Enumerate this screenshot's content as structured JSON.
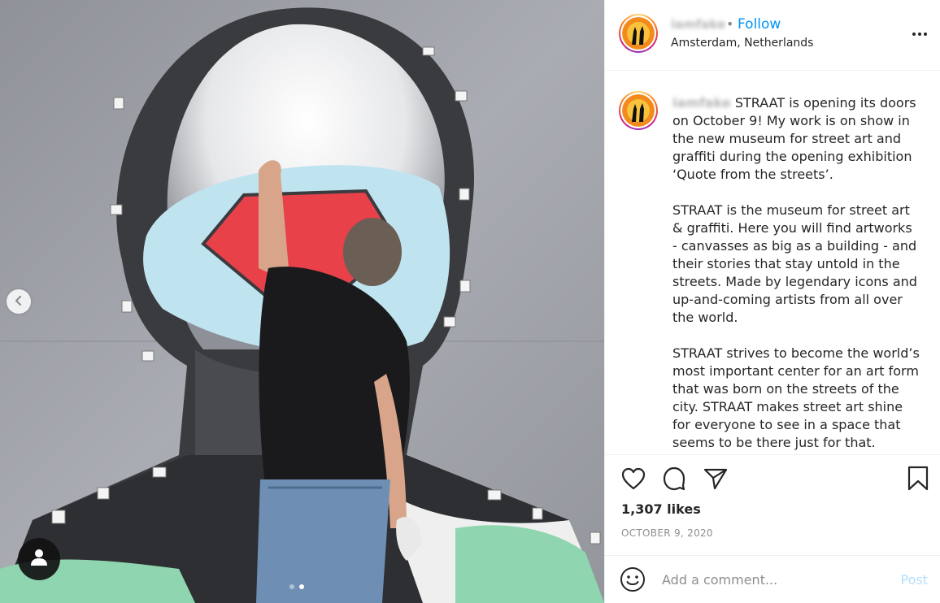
{
  "post": {
    "media": {
      "prev_icon": "chevron-left-icon",
      "tag_icon": "user-icon",
      "slide_count": 2,
      "active_slide": 2
    },
    "header": {
      "username": "iamfake",
      "separator": "•",
      "follow_label": "Follow",
      "location": "Amsterdam, Netherlands",
      "more_icon": "more-horizontal-icon"
    },
    "caption": {
      "username": "iamfake",
      "text": " STRAAT is opening its doors on October 9! My work is on show in the new museum for street art and graffiti during the opening exhibition ‘Quote from the streets’.\n\nSTRAAT is the museum for street art & graffiti. Here you will find artworks - canvasses as big as a building - and their stories that stay untold in the streets. Made by legendary icons and up-and-coming artists from all over the world.\n\nSTRAAT strives to become the world’s most important center for an art form that was born on the streets of the city. STRAAT makes street art shine for everyone to see in a space that seems to be there just for that."
    },
    "actions": {
      "like_icon": "heart-icon",
      "comment_icon": "comment-icon",
      "share_icon": "send-icon",
      "save_icon": "bookmark-icon"
    },
    "likes": "1,307 likes",
    "date": "OCTOBER 9, 2020",
    "comment_box": {
      "emoji_icon": "smiley-icon",
      "placeholder": "Add a comment...",
      "post_label": "Post"
    }
  },
  "colors": {
    "link_blue": "#0095f6",
    "post_disabled": "#b2dffc",
    "muted": "#8e8e8e",
    "text": "#262626"
  }
}
